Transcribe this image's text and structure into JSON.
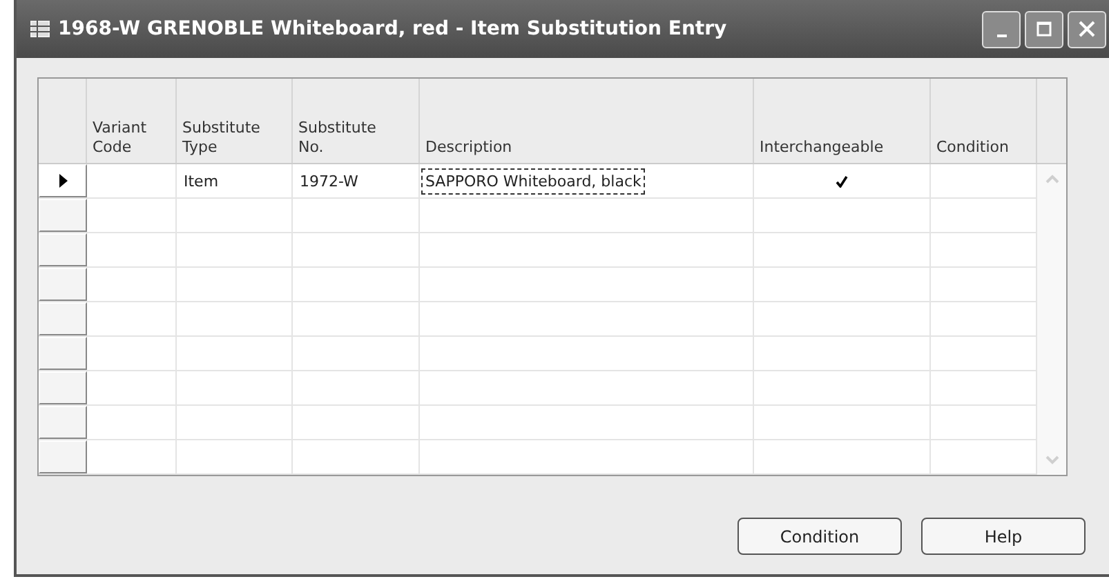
{
  "window": {
    "title": "1968-W GRENOBLE Whiteboard, red - Item Substitution Entry"
  },
  "table": {
    "columns": [
      [
        "Variant",
        "Code"
      ],
      [
        "Substitute",
        "Type"
      ],
      [
        "Substitute",
        "No."
      ],
      [
        "Description"
      ],
      [
        "Interchangeable"
      ],
      [
        "Condition"
      ]
    ],
    "rows": [
      {
        "selected": true,
        "variant_code": "",
        "substitute_type": "Item",
        "substitute_no": "1972-W",
        "description": "SAPPORO Whiteboard, black",
        "interchangeable": true,
        "focused": true
      },
      {
        "selected": false
      },
      {
        "selected": false
      },
      {
        "selected": false
      },
      {
        "selected": false
      },
      {
        "selected": false
      },
      {
        "selected": false
      },
      {
        "selected": false
      },
      {
        "selected": false
      }
    ]
  },
  "buttons": [
    "Condition",
    "Help"
  ]
}
